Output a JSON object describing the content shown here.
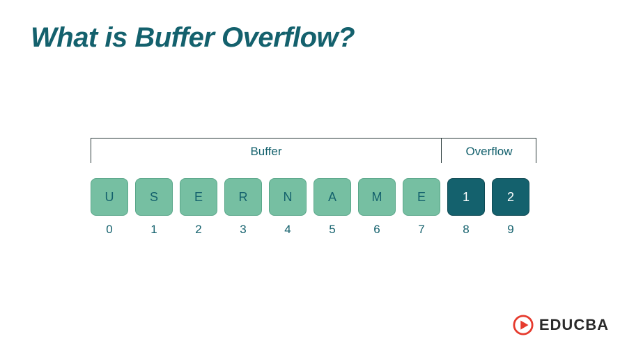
{
  "title": "What is Buffer Overflow?",
  "diagram": {
    "buffer_label": "Buffer",
    "overflow_label": "Overflow",
    "cells": [
      {
        "char": "U",
        "index": "0",
        "zone": "buffer"
      },
      {
        "char": "S",
        "index": "1",
        "zone": "buffer"
      },
      {
        "char": "E",
        "index": "2",
        "zone": "buffer"
      },
      {
        "char": "R",
        "index": "3",
        "zone": "buffer"
      },
      {
        "char": "N",
        "index": "4",
        "zone": "buffer"
      },
      {
        "char": "A",
        "index": "5",
        "zone": "buffer"
      },
      {
        "char": "M",
        "index": "6",
        "zone": "buffer"
      },
      {
        "char": "E",
        "index": "7",
        "zone": "buffer"
      },
      {
        "char": "1",
        "index": "8",
        "zone": "overflow"
      },
      {
        "char": "2",
        "index": "9",
        "zone": "overflow"
      }
    ]
  },
  "brand": {
    "name": "EDUCBA",
    "accent": "#e63b2e"
  },
  "colors": {
    "title": "#14616d",
    "buffer_cell": "#76bfa2",
    "overflow_cell": "#14616d"
  }
}
